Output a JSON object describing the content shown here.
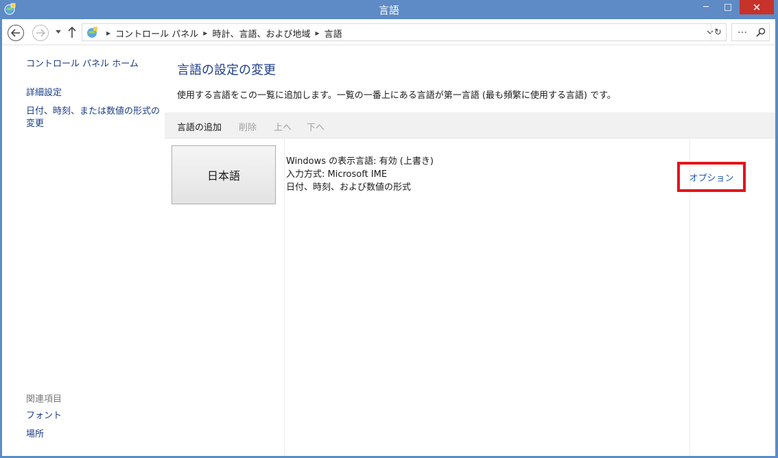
{
  "window": {
    "title": "言語",
    "min_glyph": "─",
    "max_glyph": "□",
    "close_glyph": "✕"
  },
  "address_bar": {
    "crumbs": [
      "コントロール パネル",
      "時計、言語、および地域",
      "言語"
    ],
    "refresh_glyph": "↻"
  },
  "search": {
    "ellipsis": "…"
  },
  "sidebar": {
    "home": "コントロール パネル ホーム",
    "advanced": "詳細設定",
    "datetime_line1": "日付、時刻、または数値の形式の",
    "datetime_line2": "変更",
    "related_header": "関連項目",
    "fonts": "フォント",
    "location": "場所"
  },
  "main": {
    "title": "言語の設定の変更",
    "description": "使用する言語をこの一覧に追加します。一覧の一番上にある言語が第一言語 (最も頻繁に使用する言語) です。",
    "toolbar": {
      "add": "言語の追加",
      "delete": "削除",
      "up": "上へ",
      "down": "下へ"
    },
    "language": {
      "name": "日本語",
      "info_line1": "Windows の表示言語: 有効 (上書き)",
      "info_line2": "入力方式: Microsoft IME",
      "info_line3": "日付、時刻、および数値の形式",
      "options": "オプション"
    }
  },
  "colors": {
    "titlebar": "#5e8ac5",
    "close_button": "#c7322b",
    "link": "#1a3c85",
    "title_text": "#1e3d8c",
    "highlight_box": "#e4141b"
  }
}
